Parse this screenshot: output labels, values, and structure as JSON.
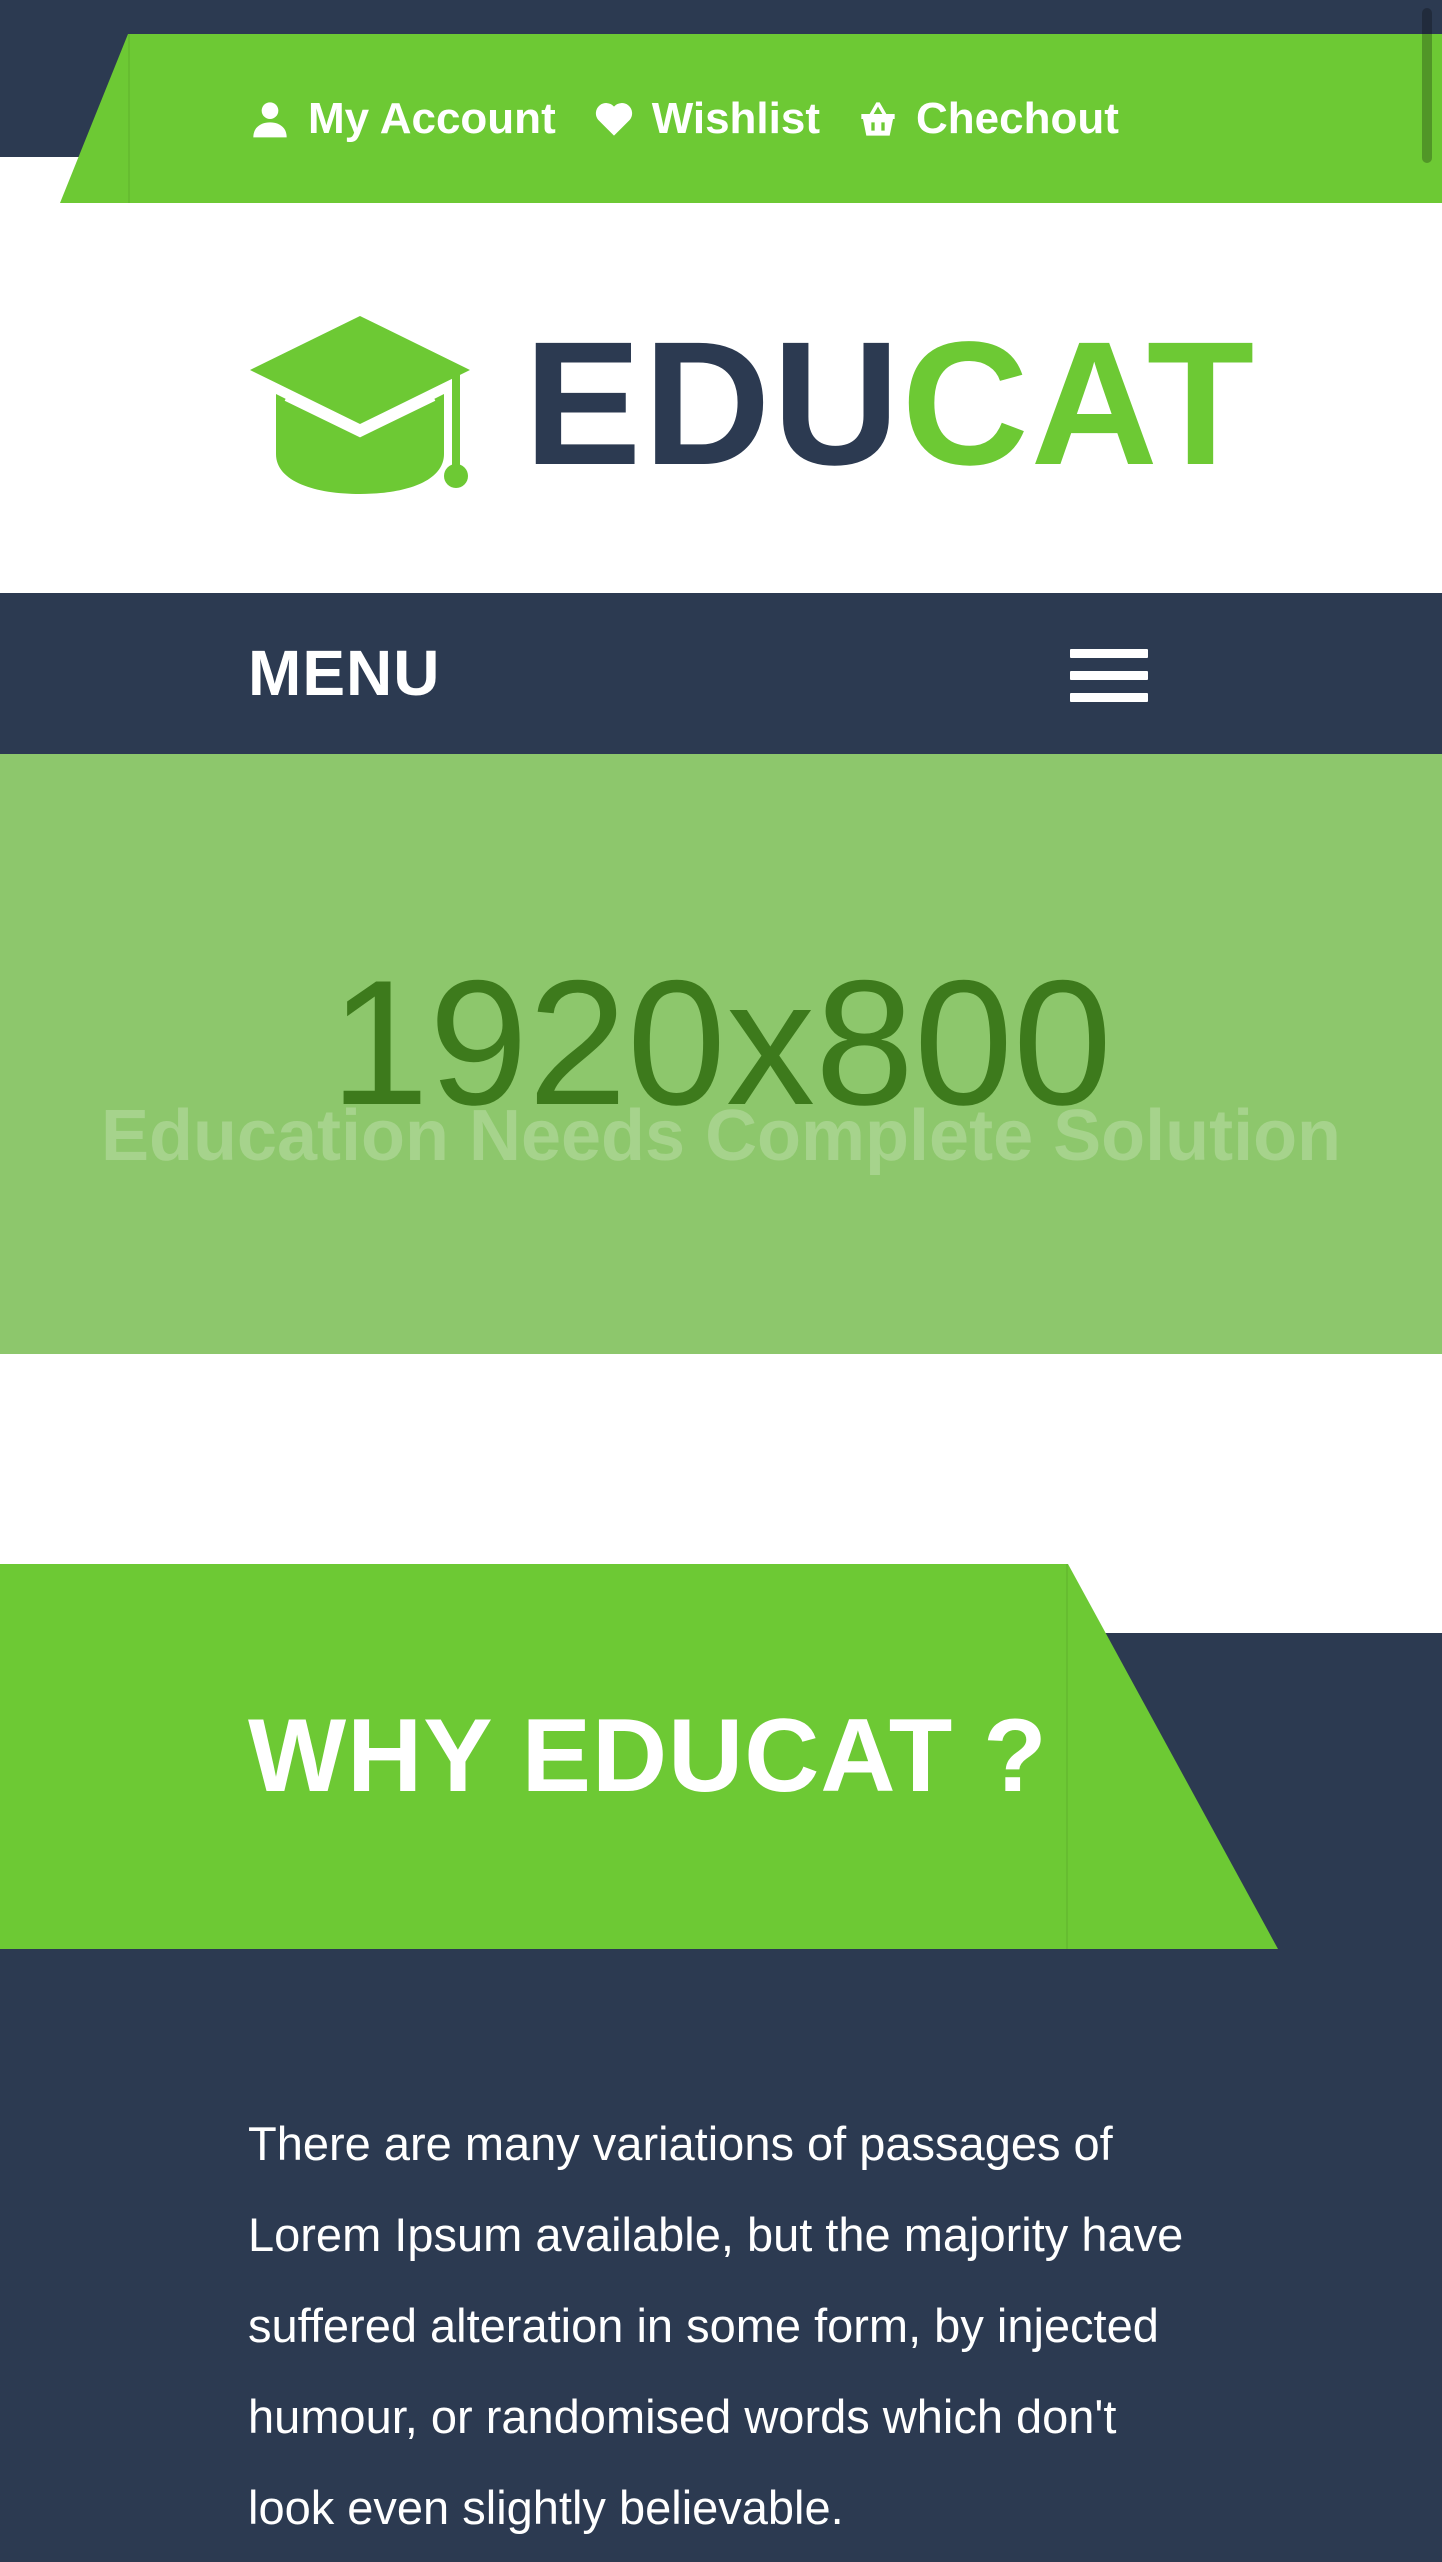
{
  "topbar": {
    "links": [
      {
        "label": "My Account",
        "icon": "user-icon"
      },
      {
        "label": "Wishlist",
        "icon": "heart-icon"
      },
      {
        "label": "Chechout",
        "icon": "basket-icon"
      }
    ]
  },
  "logo": {
    "icon": "graduation-cap-icon",
    "text_part1": "EDU",
    "text_part2": "CAT"
  },
  "menu": {
    "label": "MENU",
    "icon": "hamburger-icon"
  },
  "hero": {
    "placeholder_text": "1920x800",
    "heading": "Education Needs Complete Solution"
  },
  "why": {
    "title": "WHY EDUCAT ?",
    "text": "There are many variations of passages of Lorem Ipsum available, but the majority have suffered alteration in some form, by injected humour, or randomised words which don't look even slightly believable."
  },
  "colors": {
    "navy": "#2c3a51",
    "green": "#6dc934",
    "hero_bg": "#8dc76c",
    "placeholder_text": "#3d7a1c",
    "white": "#ffffff"
  }
}
